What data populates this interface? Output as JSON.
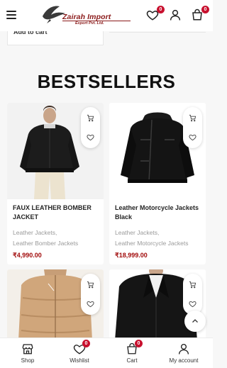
{
  "header": {
    "logo_name": "Zairah Import",
    "logo_sub": "Export Pvt. Ltd.",
    "wishlist_count": "0",
    "cart_count": "0",
    "menu_icon": "hamburger-icon",
    "wishlist_icon": "heart-icon",
    "account_icon": "user-icon",
    "cart_icon": "shopping-bag-icon"
  },
  "prev_strip": {
    "label": "Add to cart"
  },
  "section": {
    "title": "BESTSELLERS"
  },
  "products": [
    {
      "title": "FAUX LEATHER BOMBER JACKET",
      "categories": [
        "Leather Jackets,",
        "Leather Bomber Jackets"
      ],
      "price": "₹4,990.00"
    },
    {
      "title": "Leather Motorcycle Jackets Black",
      "categories": [
        "Leather Jackets,",
        "Leather Motorcycle Jackets"
      ],
      "price": "₹18,999.00"
    },
    {
      "title": "",
      "categories": [],
      "price": ""
    },
    {
      "title": "",
      "categories": [],
      "price": ""
    }
  ],
  "bottom_nav": {
    "shop": "Shop",
    "wishlist": "Wishlist",
    "wishlist_count": "0",
    "cart": "Cart",
    "cart_count": "0",
    "account": "My account"
  },
  "colors": {
    "accent": "#c8102e",
    "price": "#a10a0a",
    "brand": "#8b1a1a"
  }
}
